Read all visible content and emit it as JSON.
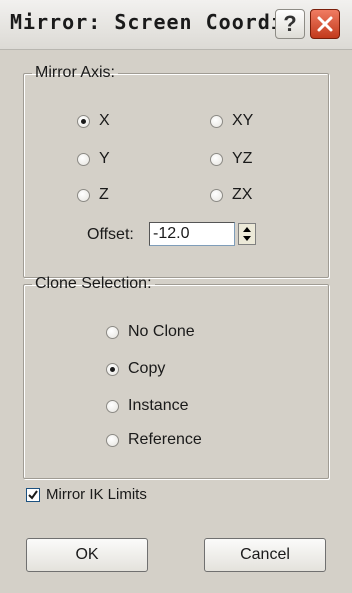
{
  "window": {
    "title": "Mirror: Screen Coordi...",
    "help_icon": "?",
    "close_icon": "close-icon"
  },
  "mirror_axis": {
    "legend": "Mirror Axis:",
    "options": [
      {
        "label": "X",
        "selected": true
      },
      {
        "label": "Y",
        "selected": false
      },
      {
        "label": "Z",
        "selected": false
      },
      {
        "label": "XY",
        "selected": false
      },
      {
        "label": "YZ",
        "selected": false
      },
      {
        "label": "ZX",
        "selected": false
      }
    ],
    "offset_label": "Offset:",
    "offset_value": "-12.0"
  },
  "clone_selection": {
    "legend": "Clone Selection:",
    "options": [
      {
        "label": "No Clone",
        "selected": false
      },
      {
        "label": "Copy",
        "selected": true
      },
      {
        "label": "Instance",
        "selected": false
      },
      {
        "label": "Reference",
        "selected": false
      }
    ]
  },
  "mirror_ik": {
    "label": "Mirror IK Limits",
    "checked": true
  },
  "buttons": {
    "ok": "OK",
    "cancel": "Cancel"
  }
}
